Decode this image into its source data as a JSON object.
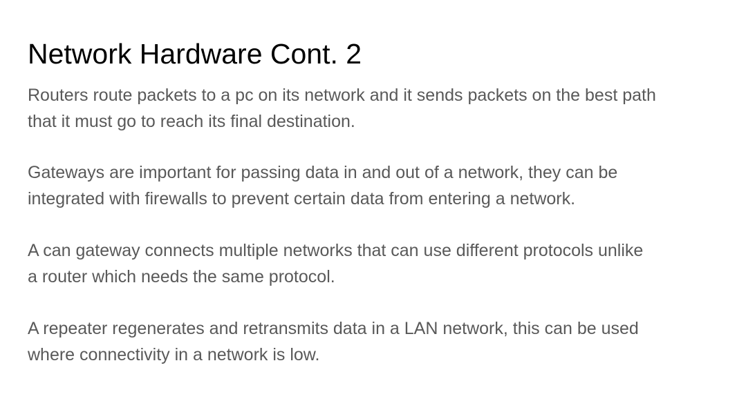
{
  "slide": {
    "title": "Network Hardware Cont. 2",
    "paragraphs": [
      {
        "line1": "Routers route packets to a pc on its network and it sends packets on the best path",
        "line2": "that it must go to reach its final destination."
      },
      {
        "line1": "Gateways are important for passing data in and out of a network, they can be",
        "line2": "integrated with firewalls to prevent certain data from entering a network."
      },
      {
        "line1": "A can gateway connects multiple networks that can use different protocols unlike",
        "line2": "a router which needs the same protocol."
      },
      {
        "line1": "A repeater regenerates and retransmits data in a LAN network, this can be used",
        "line2": "where connectivity in a network is low."
      }
    ]
  },
  "colors": {
    "title": "#000000",
    "body_text": "#595959",
    "background": "#ffffff"
  }
}
